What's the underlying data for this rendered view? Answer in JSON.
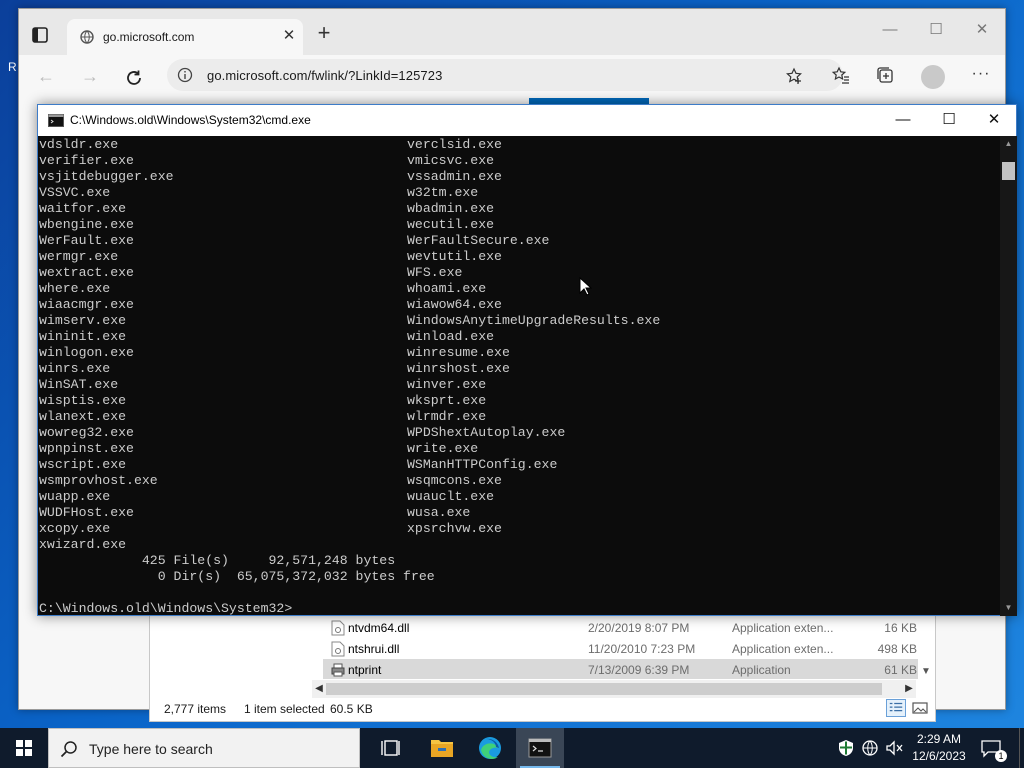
{
  "desktop": {
    "edge_letter": "R"
  },
  "browser": {
    "tab_title": "go.microsoft.com",
    "url": "go.microsoft.com/fwlink/?LinkId=125723",
    "controls": {
      "minimize": "—",
      "maximize": "☐",
      "close": "✕"
    },
    "icons": [
      "tab-actions-icon",
      "favicon-icon",
      "info-icon",
      "add-favorite-icon",
      "favorites-icon",
      "collections-icon",
      "profile-icon",
      "more-icon"
    ]
  },
  "cmd": {
    "title": "C:\\Windows.old\\Windows\\System32\\cmd.exe",
    "rows": [
      [
        "vdsldr.exe",
        "verclsid.exe"
      ],
      [
        "verifier.exe",
        "vmicsvc.exe"
      ],
      [
        "vsjitdebugger.exe",
        "vssadmin.exe"
      ],
      [
        "VSSVC.exe",
        "w32tm.exe"
      ],
      [
        "waitfor.exe",
        "wbadmin.exe"
      ],
      [
        "wbengine.exe",
        "wecutil.exe"
      ],
      [
        "WerFault.exe",
        "WerFaultSecure.exe"
      ],
      [
        "wermgr.exe",
        "wevtutil.exe"
      ],
      [
        "wextract.exe",
        "WFS.exe"
      ],
      [
        "where.exe",
        "whoami.exe"
      ],
      [
        "wiaacmgr.exe",
        "wiawow64.exe"
      ],
      [
        "wimserv.exe",
        "WindowsAnytimeUpgradeResults.exe"
      ],
      [
        "wininit.exe",
        "winload.exe"
      ],
      [
        "winlogon.exe",
        "winresume.exe"
      ],
      [
        "winrs.exe",
        "winrshost.exe"
      ],
      [
        "WinSAT.exe",
        "winver.exe"
      ],
      [
        "wisptis.exe",
        "wksprt.exe"
      ],
      [
        "wlanext.exe",
        "wlrmdr.exe"
      ],
      [
        "wowreg32.exe",
        "WPDShextAutoplay.exe"
      ],
      [
        "wpnpinst.exe",
        "write.exe"
      ],
      [
        "wscript.exe",
        "WSManHTTPConfig.exe"
      ],
      [
        "wsmprovhost.exe",
        "wsqmcons.exe"
      ],
      [
        "wuapp.exe",
        "wuauclt.exe"
      ],
      [
        "WUDFHost.exe",
        "wusa.exe"
      ],
      [
        "xcopy.exe",
        "xpsrchvw.exe"
      ],
      [
        "xwizard.exe",
        ""
      ]
    ],
    "summary_files": "             425 File(s)     92,571,248 bytes",
    "summary_dirs": "               0 Dir(s)  65,075,372,032 bytes free",
    "blank": "",
    "prompt": "C:\\Windows.old\\Windows\\System32>"
  },
  "explorer": {
    "rows": [
      {
        "name": "ntvdm64.dll",
        "date": "2/20/2019 8:07 PM",
        "type": "Application exten...",
        "size": "16 KB",
        "selected": false
      },
      {
        "name": "ntshrui.dll",
        "date": "11/20/2010 7:23 PM",
        "type": "Application exten...",
        "size": "498 KB",
        "selected": false
      },
      {
        "name": "ntprint",
        "date": "7/13/2009 6:39 PM",
        "type": "Application",
        "size": "61 KB",
        "selected": true
      }
    ],
    "status": {
      "items": "2,777 items",
      "selected": "1 item selected",
      "size": "60.5 KB"
    }
  },
  "taskbar": {
    "search_placeholder": "Type here to search",
    "time": "2:29 AM",
    "date": "12/6/2023",
    "notification_count": "1"
  },
  "colors": {
    "console_text": "#cccccc",
    "console_bg": "#0c0c0c",
    "accent": "#0067b8",
    "taskbar": "#0f1b2c"
  }
}
